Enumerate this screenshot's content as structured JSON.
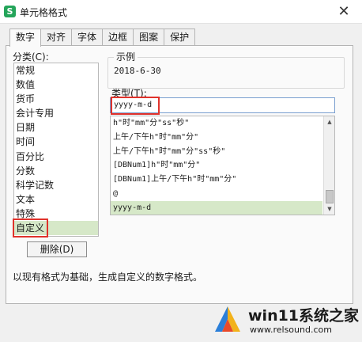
{
  "window": {
    "title": "单元格格式",
    "close_glyph": "✕",
    "app_icon_letter": "S",
    "accent": "#24a55a"
  },
  "tabs": [
    {
      "label": "数字",
      "active": true
    },
    {
      "label": "对齐"
    },
    {
      "label": "字体"
    },
    {
      "label": "边框"
    },
    {
      "label": "图案"
    },
    {
      "label": "保护"
    }
  ],
  "category": {
    "label": "分类(C):",
    "items": [
      "常规",
      "数值",
      "货币",
      "会计专用",
      "日期",
      "时间",
      "百分比",
      "分数",
      "科学记数",
      "文本",
      "特殊",
      "自定义"
    ],
    "selected": "自定义"
  },
  "sample": {
    "label": "示例",
    "value": "2018-6-30"
  },
  "type": {
    "label": "类型(T):",
    "value": "yyyy-m-d"
  },
  "format_list": {
    "items": [
      "h\"时\"mm\"分\"ss\"秒\"",
      "上午/下午h\"时\"mm\"分\"",
      "上午/下午h\"时\"mm\"分\"ss\"秒\"",
      "[DBNum1]h\"时\"mm\"分\"",
      "[DBNum1]上午/下午h\"时\"mm\"分\"",
      "@",
      "yyyy-m-d"
    ],
    "selected": "yyyy-m-d"
  },
  "buttons": {
    "delete_label": "删除(D)"
  },
  "description": "以现有格式为基础，生成自定义的数字格式。",
  "colors": {
    "selection": "#d6e8c8",
    "highlight_box": "#e0322b"
  },
  "watermark": {
    "title": "win11系统之家",
    "url": "www.relsound.com"
  }
}
